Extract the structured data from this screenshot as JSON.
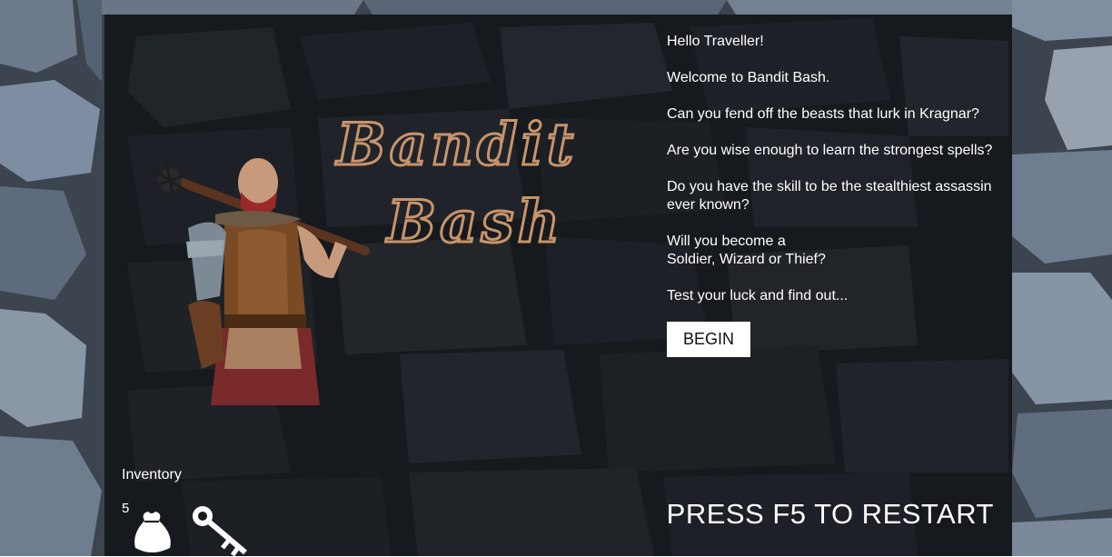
{
  "game": {
    "title_line1": "Bandit",
    "title_line2": "Bash"
  },
  "intro": {
    "greeting": "Hello Traveller!",
    "welcome": "Welcome to Bandit Bash.",
    "q1": "Can you fend off the beasts that lurk in Kragnar?",
    "q2": "Are you wise enough to learn the strongest spells?",
    "q3": "Do you have the skill to be the stealthiest assassin ever known?",
    "q4_line1": "Will you become a",
    "q4_line2": "Soldier, Wizard or Thief?",
    "closing": "Test your luck and find out...",
    "begin_label": "BEGIN"
  },
  "inventory": {
    "label": "Inventory",
    "count": "5",
    "items": [
      "money-bag-icon",
      "key-icon"
    ]
  },
  "footer": {
    "restart_text": "PRESS F5 TO RESTART"
  },
  "colors": {
    "title": "#c8946a",
    "panel": "rgba(0,0,0,0.62)",
    "button_bg": "#ffffff"
  }
}
